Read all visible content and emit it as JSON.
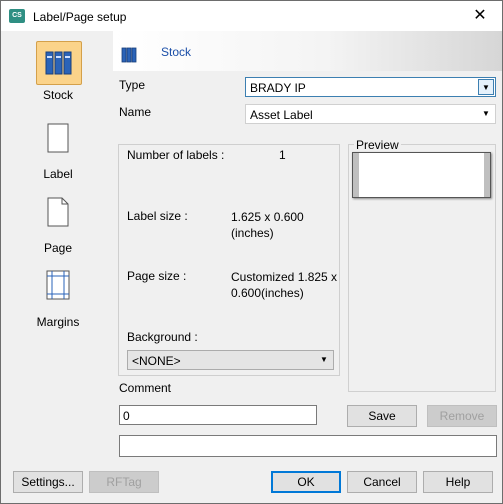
{
  "window": {
    "title": "Label/Page setup",
    "app_icon_text": "CS"
  },
  "sidebar": {
    "items": [
      {
        "label": "Stock",
        "icon": "stock-books-icon",
        "selected": true
      },
      {
        "label": "Label",
        "icon": "label-page-icon"
      },
      {
        "label": "Page",
        "icon": "page-icon"
      },
      {
        "label": "Margins",
        "icon": "margins-icon"
      }
    ]
  },
  "banner": {
    "title": "Stock"
  },
  "form": {
    "type_label": "Type",
    "type_value": "BRADY IP",
    "name_label": "Name",
    "name_value": "Asset Label"
  },
  "info": {
    "number_of_labels_label": "Number of labels :",
    "number_of_labels_value": "1",
    "label_size_label": "Label size :",
    "label_size_value": "1.625 x 0.600 (inches)",
    "page_size_label": "Page size :",
    "page_size_value": "Customized 1.825 x 0.600(inches)",
    "background_label": "Background :",
    "background_value": "<NONE>"
  },
  "preview": {
    "legend": "Preview"
  },
  "comment": {
    "label": "Comment",
    "value": "0",
    "save_label": "Save",
    "remove_label": "Remove"
  },
  "footer": {
    "settings_label": "Settings...",
    "rftag_label": "RFTag",
    "ok_label": "OK",
    "cancel_label": "Cancel",
    "help_label": "Help"
  },
  "colors": {
    "banner_title": "#1b4fa8",
    "selected_item_bg": "#fbd38a",
    "focus_border": "#3c7fb1"
  }
}
